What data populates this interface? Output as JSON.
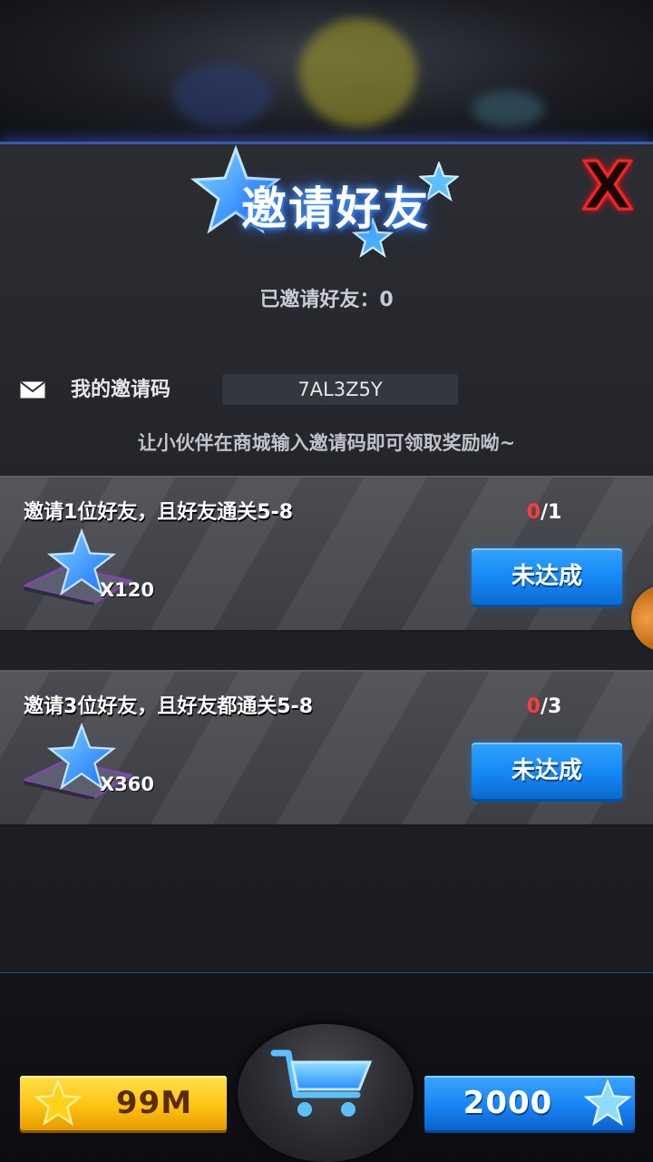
{
  "dialog": {
    "title": "邀请好友",
    "invited_count": "已邀请好友：0",
    "close_label": "X"
  },
  "invite_code": {
    "label": "我的邀请码",
    "code": "7AL3Z5Y",
    "hint": "让小伙伴在商城输入邀请码即可领取奖励呦~"
  },
  "tasks": [
    {
      "title": "邀请1位好友，且好友通关5-8",
      "progress_current": "0",
      "progress_total": "/1",
      "reward_qty": "X120",
      "button_label": "未达成"
    },
    {
      "title": "邀请3位好友，且好友都通关5-8",
      "progress_current": "0",
      "progress_total": "/3",
      "reward_qty": "X360",
      "button_label": "未达成"
    }
  ],
  "currency": {
    "gold": "99M",
    "gems": "2000"
  },
  "colors": {
    "accent_blue": "#1487f5",
    "gold": "#ffc414",
    "progress_red": "#ff3b3b",
    "close_red": "#ff2222"
  },
  "icons": {
    "title": "star-icon",
    "close": "close-icon",
    "mail": "mail-icon",
    "reward": "blue-star-gem-icon",
    "shop": "shopping-cart-icon",
    "gold": "gold-star-icon",
    "gems": "blue-star-icon"
  }
}
